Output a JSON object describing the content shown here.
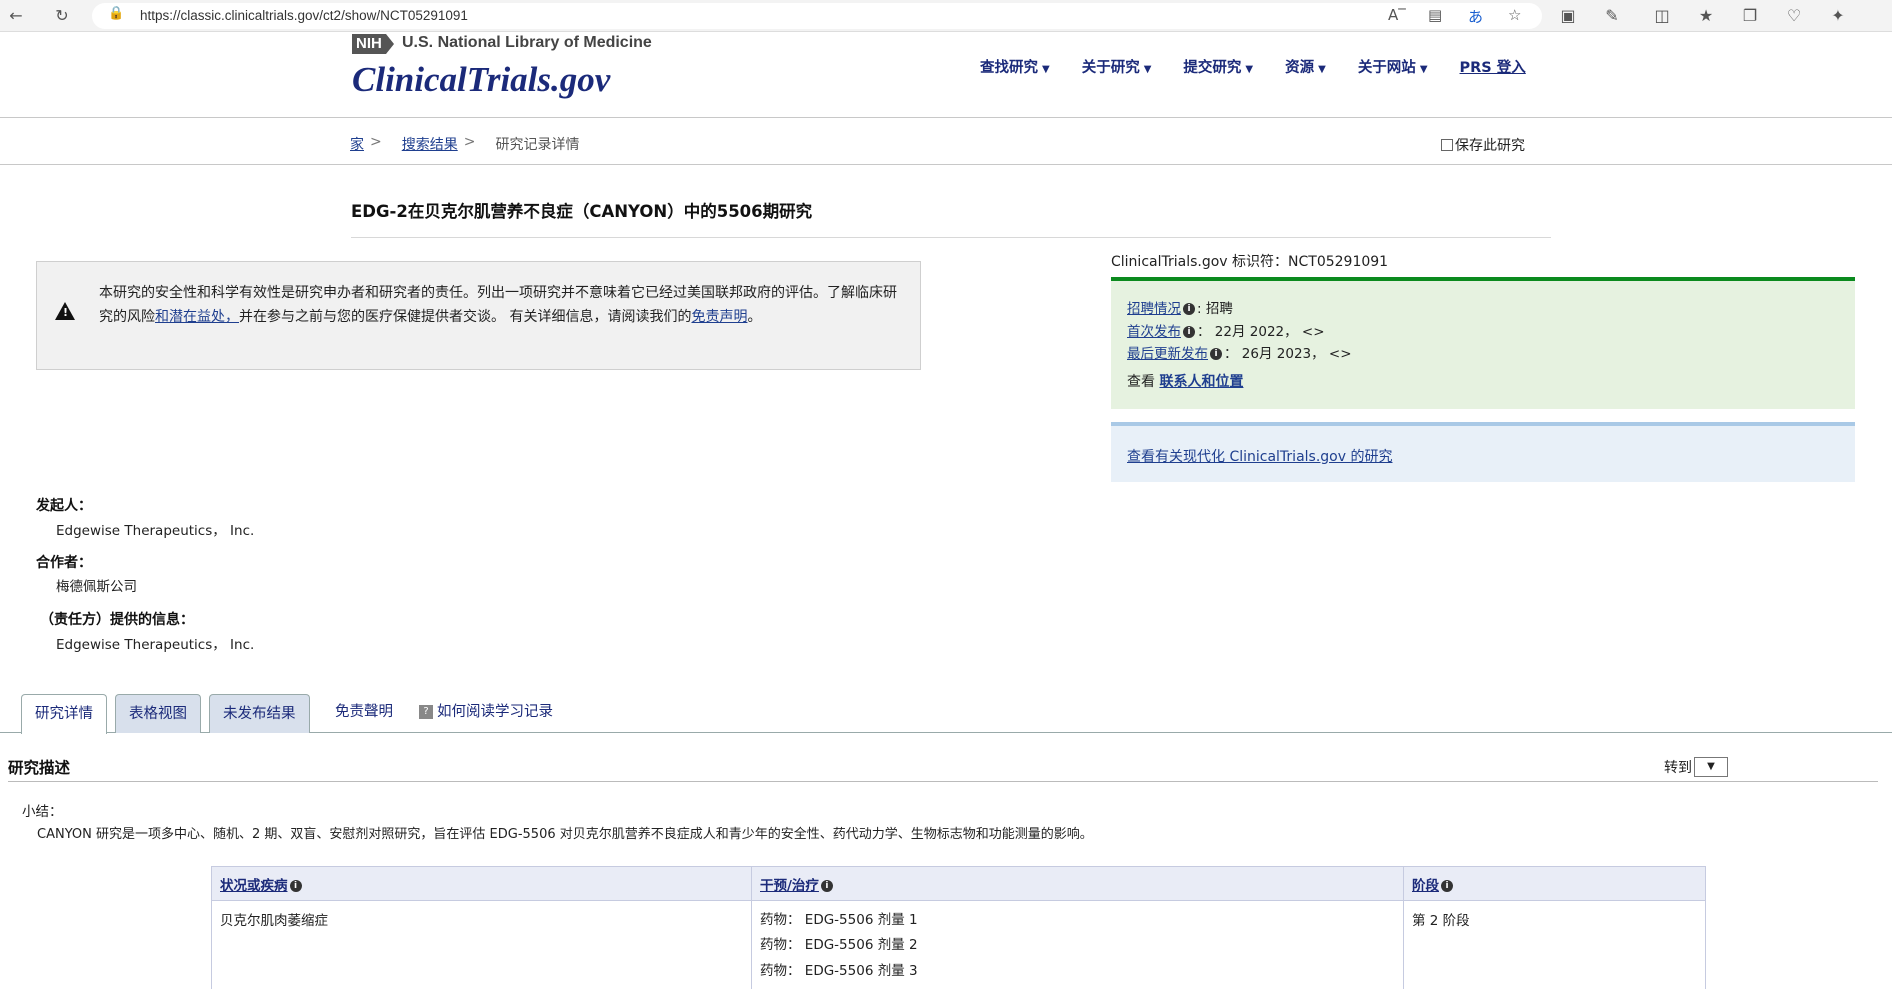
{
  "browser": {
    "url": "https://classic.clinicaltrials.gov/ct2/show/NCT05291091"
  },
  "header": {
    "nih_badge": "NIH",
    "nih_text": "U.S. National Library of Medicine",
    "brand": "ClinicalTrials.gov",
    "nav": [
      "查找研究",
      "关于研究",
      "提交研究",
      "资源",
      "关于网站"
    ],
    "prs_login": "PRS 登入"
  },
  "breadcrumb": {
    "home": "家",
    "search_results": "搜索结果",
    "current": "研究记录详情",
    "save_study": "保存此研究"
  },
  "study": {
    "title": "EDG-2在贝克尔肌营养不良症（CANYON）中的5506期研究",
    "disclaimer_1": "本研究的安全性和科学有效性是研究申办者和研究者的责任。列出一项研究并不意味着它已经过美国联邦政府的评估。了解临床研究的风险",
    "disclaimer_link_1": "和潜在益处，",
    "disclaimer_2": "并在参与之前与您的医疗保健提供者交谈。 有关详细信息，请阅读我们的",
    "disclaimer_link_2": "免责声明",
    "disclaimer_end": "。"
  },
  "status": {
    "identifier_label": "ClinicalTrials.gov 标识符：",
    "identifier": "NCT05291091",
    "recruitment_label": "招聘情况",
    "recruitment_value": ": 招聘",
    "first_posted_label": "首次发布",
    "first_posted_value": "：  22月 2022，  <>",
    "last_update_label": "最后更新发布",
    "last_update_value": "：  26月 2023，  <>",
    "view_prefix": "查看 ",
    "contacts_link": "联系人和位置",
    "modernize_link": "查看有关现代化 ClinicalTrials.gov 的研究"
  },
  "sponsor": {
    "sponsor_label": "发起人：",
    "sponsor_value": "Edgewise Therapeutics， Inc.",
    "collaborator_label": "合作者：",
    "collaborator_value": "梅德佩斯公司",
    "info_label": "（责任方）提供的信息：",
    "info_value": "Edgewise Therapeutics， Inc."
  },
  "tabs": {
    "details": "研究详情",
    "tabular": "表格视图",
    "no_results": "未发布结果",
    "disclaimer": "免责聲明",
    "how_to_read": "如何阅读学习记录"
  },
  "section": {
    "title": "研究描述",
    "goto": "转到",
    "summary_label": "小结：",
    "summary_text": "CANYON 研究是一项多中心、随机、2 期、双盲、安慰剂对照研究，旨在评估 EDG-5506 对贝克尔肌营养不良症成人和青少年的安全性、药代动力学、生物标志物和功能测量的影响。"
  },
  "table": {
    "headers": [
      "状况或疾病",
      "干预/治疗",
      "阶段"
    ],
    "condition": "贝克尔肌肉萎缩症",
    "interventions": [
      "药物：   EDG-5506 剂量 1",
      "药物：   EDG-5506 剂量 2",
      "药物：   EDG-5506 剂量 3"
    ],
    "phase": "第 2 阶段"
  }
}
